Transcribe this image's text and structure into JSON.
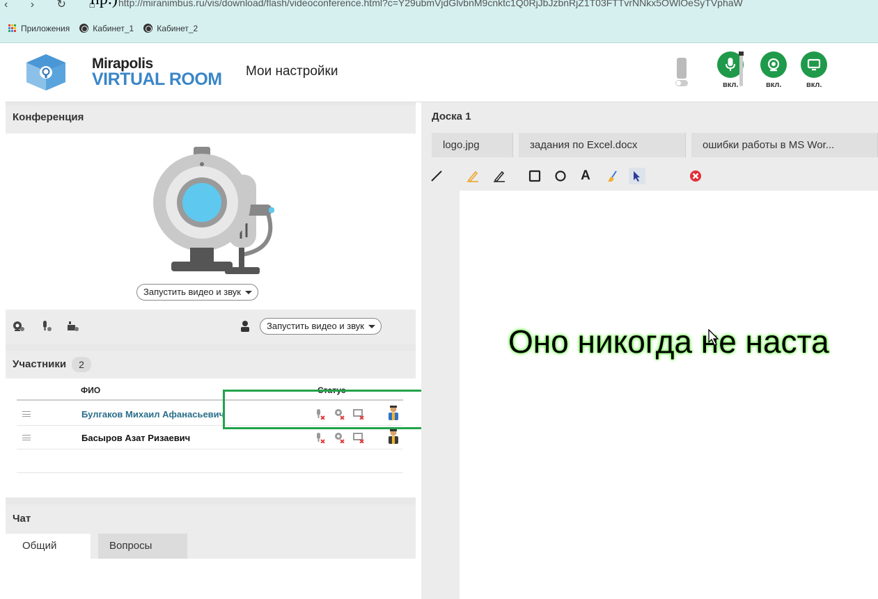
{
  "browser": {
    "cut_text": "пр.)",
    "nav_icons": [
      "back-icon",
      "forward-icon",
      "reload-icon",
      "home-icon"
    ],
    "url": "http://miranimbus.ru/vis/download/flash/videoconference.html?c=Y29ubmVjdGlvbnM9cnktc1Q0RjJbJzbnRjZ1T03FTTvrNNkx5OWlOeSyTVphaW"
  },
  "bookmarks": {
    "apps_label": "Приложения",
    "items": [
      "Кабинет_1",
      "Кабинет_2"
    ]
  },
  "header": {
    "brand_line1": "Mirapolis",
    "brand_line2": "VIRTUAL ROOM",
    "settings_link": "Мои настройки",
    "controls": [
      {
        "icon": "microphone-icon",
        "label": "вкл."
      },
      {
        "icon": "webcam-icon",
        "label": "вкл."
      },
      {
        "icon": "screen-icon",
        "label": "вкл."
      }
    ],
    "accent_color": "#1f9a4a"
  },
  "conference": {
    "title": "Конференция",
    "start_button": "Запустить видео и звук",
    "bottom_start_button": "Запустить видео и звук",
    "tool_icons": [
      "webcam-settings-icon",
      "mic-settings-icon",
      "camera-settings-icon"
    ]
  },
  "participants": {
    "title": "Участники",
    "count": "2",
    "columns": {
      "name": "ФИО",
      "status": "Статус"
    },
    "rows": [
      {
        "name": "Булгаков Михаил Афанасьевич",
        "name_color": "#2a6f8a",
        "role_icon": "presenter-icon"
      },
      {
        "name": "Басыров Азат Ризаевич",
        "name_color": "#111111",
        "role_icon": "participant-icon"
      }
    ]
  },
  "chat": {
    "title": "Чат",
    "tabs": [
      "Общий",
      "Вопросы"
    ]
  },
  "board": {
    "title": "Доска 1",
    "file_tabs": [
      "logo.jpg",
      "задания по Excel.docx",
      "ошибки работы в MS Wor..."
    ],
    "tools": [
      "line-icon",
      "pencil-icon",
      "marker-icon",
      "rectangle-icon",
      "circle-icon",
      "text-icon",
      "eraser-icon",
      "pointer-icon",
      "clear-icon"
    ],
    "text": "Оно никогда не наста"
  }
}
